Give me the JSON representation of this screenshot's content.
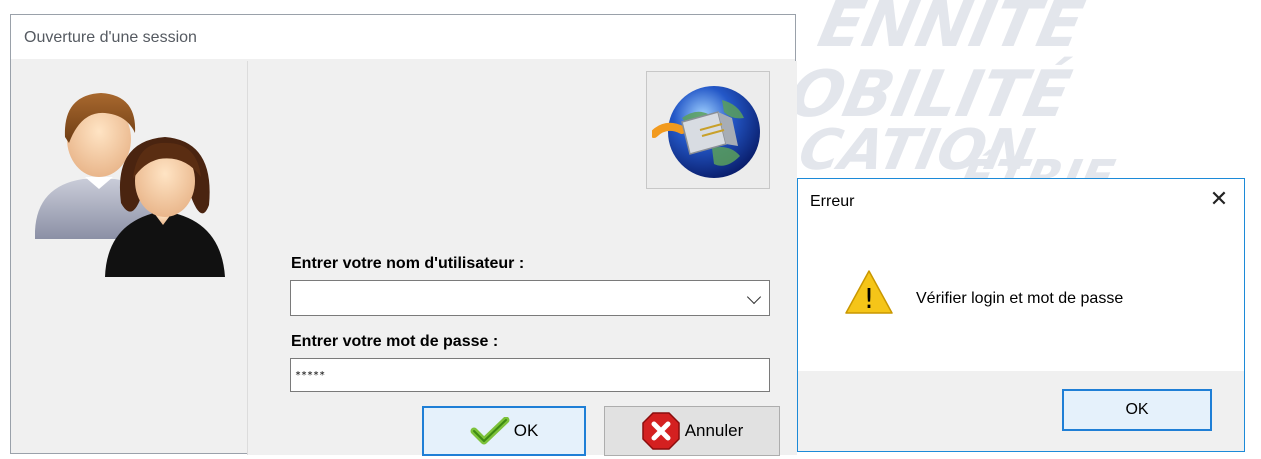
{
  "background": {
    "words": [
      "ENNITE",
      "OBILITÉ",
      "CATION",
      "ÉTRIE"
    ]
  },
  "login_window": {
    "title": "Ouverture d'une session",
    "username_label": "Entrer votre nom d'utilisateur :",
    "username_value": "",
    "password_label": "Entrer votre mot de passe :",
    "password_value": "*****",
    "ok_label": "OK",
    "cancel_label": "Annuler",
    "icons": {
      "avatar": "users-avatar-icon",
      "network": "globe-network-plug-icon",
      "ok": "checkmark-icon",
      "cancel": "red-x-icon"
    },
    "colors": {
      "focus_border": "#1f7fd6",
      "panel": "#f0f0f0"
    }
  },
  "error_dialog": {
    "title": "Erreur",
    "close_glyph": "✕",
    "warning_glyph": "!",
    "message": "Vérifier login et mot de passe",
    "ok_label": "OK",
    "colors": {
      "border": "#1c8ad8",
      "warning": "#f5c518"
    }
  }
}
